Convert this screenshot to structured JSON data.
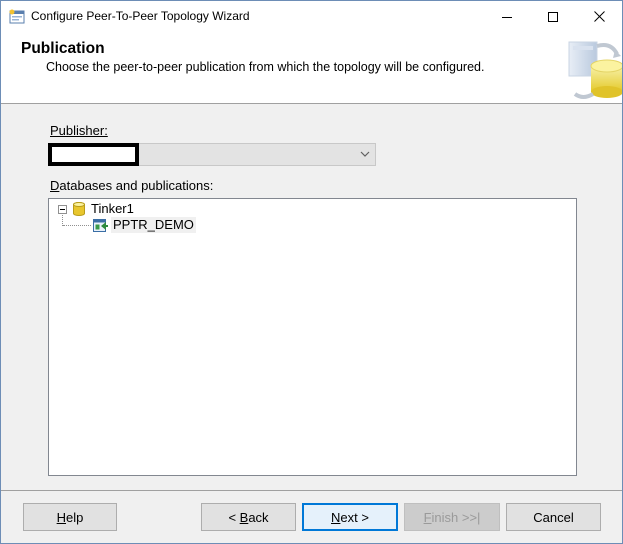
{
  "window": {
    "title": "Configure Peer-To-Peer Topology Wizard"
  },
  "header": {
    "title": "Publication",
    "subtitle": "Choose the peer-to-peer publication from which the topology will be configured."
  },
  "form": {
    "publisher_label": "Publisher:",
    "publisher_value": "",
    "publisher_value_redacted": true,
    "databases_label": "Databases and publications:"
  },
  "tree": {
    "server": {
      "label": "Tinker1",
      "expanded": true,
      "icon": "database-icon"
    },
    "publication": {
      "label": "PPTR_DEMO",
      "icon": "publication-icon",
      "selected": true
    }
  },
  "buttons": {
    "help": {
      "prefix": "",
      "mnemonic": "H",
      "suffix": "elp"
    },
    "back": {
      "prefix": "< ",
      "mnemonic": "B",
      "suffix": "ack"
    },
    "next": {
      "prefix": "",
      "mnemonic": "N",
      "suffix": "ext >"
    },
    "finish": {
      "prefix": "",
      "mnemonic": "F",
      "suffix": "inish >>|",
      "disabled": true
    },
    "cancel": {
      "label": "Cancel"
    }
  },
  "colors": {
    "accent": "#0078d7",
    "button_face": "#e1e1e1",
    "dialog_bg": "#f0f0f0"
  }
}
